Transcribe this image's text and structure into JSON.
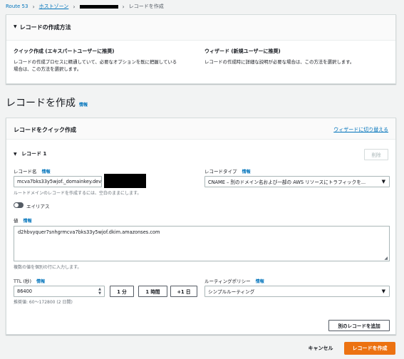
{
  "breadcrumb": {
    "route53": "Route 53",
    "hosted_zones": "ホストゾーン",
    "current": "レコードを作成"
  },
  "method_panel": {
    "title": "レコードの作成方法",
    "quick": {
      "title": "クイック作成 (エキスパートユーザーに推奨)",
      "desc_line1": "レコードの作成プロセスに精通していて、必要なオプションを既に把握している",
      "desc_line2": "場合は、この方法を選択します。"
    },
    "wizard": {
      "title": "ウィザード (新規ユーザーに推奨)",
      "desc": "レコードの作成時に詳細な説明が必要な場合は、この方法を選択します。"
    }
  },
  "page_title": "レコードを作成",
  "info_label": "情報",
  "create_panel": {
    "title": "レコードをクイック作成",
    "switch_wizard": "ウィザードに切り替える",
    "record_header": "レコード 1",
    "delete": "削除",
    "record_name_label": "レコード名",
    "record_name_value": "mcva7bks33y5wjof._domainkey.dev",
    "record_name_hint": "ルートドメインのレコードを作成するには、空白のままにします。",
    "record_type_label": "レコードタイプ",
    "record_type_value": "CNAME – 別のドメイン名および一部の AWS リソースにトラフィックを...",
    "alias_label": "エイリアス",
    "value_label": "値",
    "value_text": "d2hbvyquer7snhgrmcva7bks33y5wjof.dkim.amazonses.com",
    "value_hint": "複数の値を個別の行に入力します。",
    "ttl_label": "TTL (秒)",
    "ttl_value": "86400",
    "ttl_1min": "1 分",
    "ttl_1hour": "1 時間",
    "ttl_1day": "+1 日",
    "ttl_hint": "推奨値: 60～172800 (2 日間)",
    "routing_label": "ルーティングポリシー",
    "routing_value": "シンプルルーティング",
    "add_record": "別のレコードを追加"
  },
  "footer": {
    "cancel": "キャンセル",
    "create": "レコードを作成"
  }
}
